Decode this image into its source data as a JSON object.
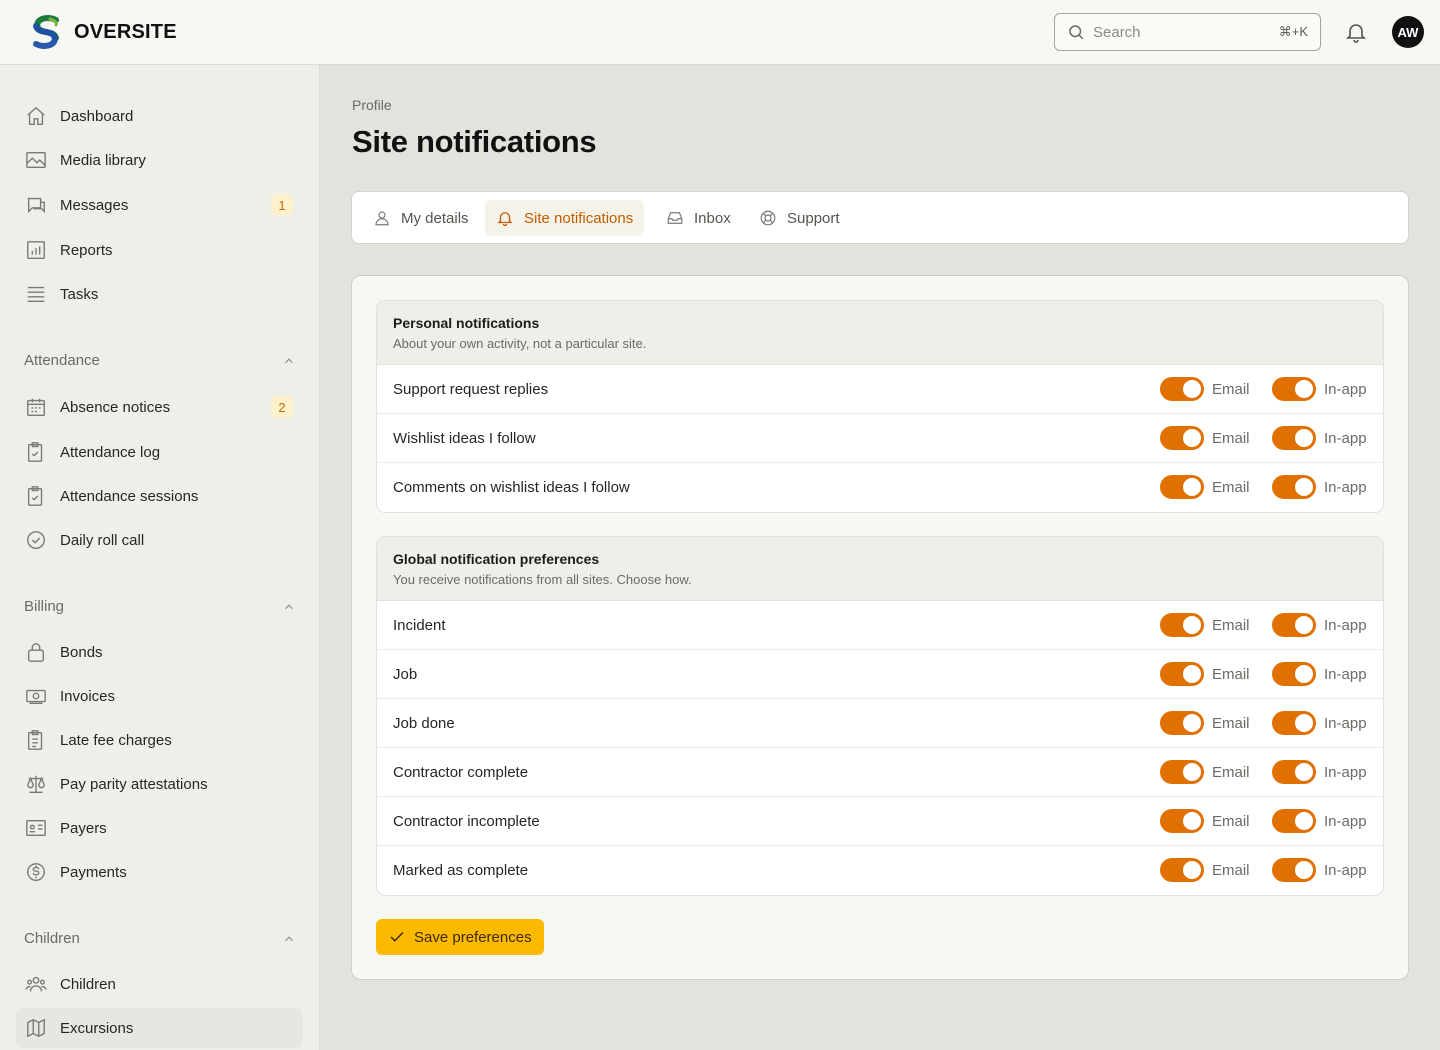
{
  "app": {
    "name": "OVERSITE"
  },
  "header": {
    "search_placeholder": "Search",
    "search_shortcut": "⌘+K",
    "avatar_initials": "AW"
  },
  "sidebar": {
    "main": [
      {
        "label": "Dashboard",
        "icon": "home-icon"
      },
      {
        "label": "Media library",
        "icon": "image-icon"
      },
      {
        "label": "Messages",
        "icon": "chat-icon",
        "badge": "1"
      },
      {
        "label": "Reports",
        "icon": "chart-icon"
      },
      {
        "label": "Tasks",
        "icon": "list-icon"
      }
    ],
    "attendance": {
      "title": "Attendance",
      "items": [
        {
          "label": "Absence notices",
          "icon": "calendar-icon",
          "badge": "2"
        },
        {
          "label": "Attendance log",
          "icon": "clipboard-check-icon"
        },
        {
          "label": "Attendance sessions",
          "icon": "clipboard-check-icon"
        },
        {
          "label": "Daily roll call",
          "icon": "check-circle-icon"
        }
      ]
    },
    "billing": {
      "title": "Billing",
      "items": [
        {
          "label": "Bonds",
          "icon": "lock-icon"
        },
        {
          "label": "Invoices",
          "icon": "banknote-icon"
        },
        {
          "label": "Late fee charges",
          "icon": "clipboard-list-icon"
        },
        {
          "label": "Pay parity attestations",
          "icon": "scale-icon"
        },
        {
          "label": "Payers",
          "icon": "id-card-icon"
        },
        {
          "label": "Payments",
          "icon": "dollar-circle-icon"
        }
      ]
    },
    "children": {
      "title": "Children",
      "items": [
        {
          "label": "Children",
          "icon": "users-icon"
        },
        {
          "label": "Excursions",
          "icon": "map-icon"
        }
      ]
    }
  },
  "page": {
    "breadcrumb": "Profile",
    "title": "Site notifications"
  },
  "tabs": [
    {
      "label": "My details",
      "icon": "user-icon"
    },
    {
      "label": "Site notifications",
      "icon": "bell-icon"
    },
    {
      "label": "Inbox",
      "icon": "inbox-icon"
    },
    {
      "label": "Support",
      "icon": "lifebuoy-icon"
    }
  ],
  "toggle_labels": {
    "email": "Email",
    "inapp": "In-app"
  },
  "personal": {
    "title": "Personal notifications",
    "subtitle": "About your own activity, not a particular site.",
    "rows": [
      {
        "label": "Support request replies",
        "email": true,
        "inapp": true
      },
      {
        "label": "Wishlist ideas I follow",
        "email": true,
        "inapp": true
      },
      {
        "label": "Comments on wishlist ideas I follow",
        "email": true,
        "inapp": true
      }
    ]
  },
  "global": {
    "title": "Global notification preferences",
    "subtitle": "You receive notifications from all sites. Choose how.",
    "rows": [
      {
        "label": "Incident",
        "email": true,
        "inapp": true
      },
      {
        "label": "Job",
        "email": true,
        "inapp": true
      },
      {
        "label": "Job done",
        "email": true,
        "inapp": true
      },
      {
        "label": "Contractor complete",
        "email": true,
        "inapp": true
      },
      {
        "label": "Contractor incomplete",
        "email": true,
        "inapp": true
      },
      {
        "label": "Marked as complete",
        "email": true,
        "inapp": true
      }
    ]
  },
  "save_label": "Save preferences",
  "colors": {
    "accent": "#e07000",
    "button": "#fbb900",
    "tab_active": "#c25e00"
  }
}
